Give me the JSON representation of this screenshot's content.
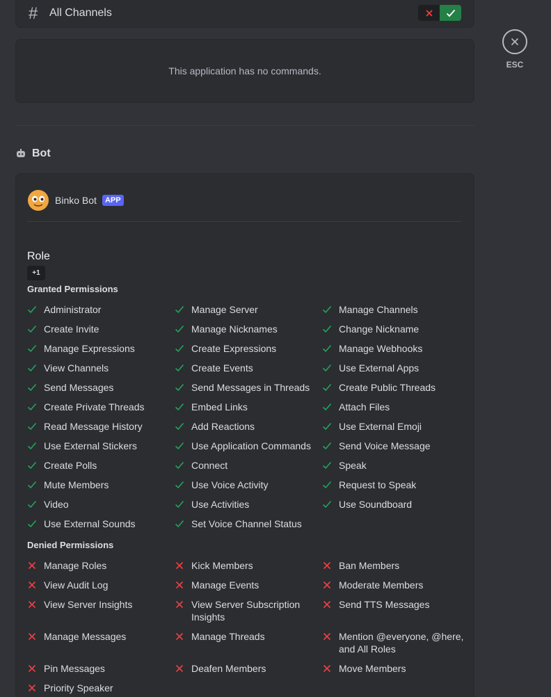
{
  "channel": {
    "hash": "#",
    "name": "All Channels"
  },
  "no_commands": "This application has no commands.",
  "bot_section": {
    "title": "Bot",
    "bot_name": "Binko Bot",
    "badge": "APP",
    "role_title": "Role",
    "role_chip": "+1",
    "granted_title": "Granted Permissions",
    "denied_title": "Denied Permissions"
  },
  "granted": [
    "Administrator",
    "Manage Server",
    "Manage Channels",
    "Create Invite",
    "Manage Nicknames",
    "Change Nickname",
    "Manage Expressions",
    "Create Expressions",
    "Manage Webhooks",
    "View Channels",
    "Create Events",
    "Use External Apps",
    "Send Messages",
    "Send Messages in Threads",
    "Create Public Threads",
    "Create Private Threads",
    "Embed Links",
    "Attach Files",
    "Read Message History",
    "Add Reactions",
    "Use External Emoji",
    "Use External Stickers",
    "Use Application Commands",
    "Send Voice Message",
    "Create Polls",
    "Connect",
    "Speak",
    "Mute Members",
    "Use Voice Activity",
    "Request to Speak",
    "Video",
    "Use Activities",
    "Use Soundboard",
    "Use External Sounds",
    "Set Voice Channel Status"
  ],
  "denied": [
    "Manage Roles",
    "Kick Members",
    "Ban Members",
    "View Audit Log",
    "Manage Events",
    "Moderate Members",
    "View Server Insights",
    "View Server Subscription Insights",
    "Send TTS Messages",
    "Manage Messages",
    "Manage Threads",
    "Mention @everyone, @here, and All Roles",
    "Pin Messages",
    "Deafen Members",
    "Move Members",
    "Priority Speaker"
  ],
  "esc_label": "ESC",
  "colors": {
    "granted": "#23a55a",
    "denied": "#f23f43",
    "accent": "#5865f2"
  },
  "icons": {
    "granted": "check-icon",
    "denied": "x-icon"
  }
}
